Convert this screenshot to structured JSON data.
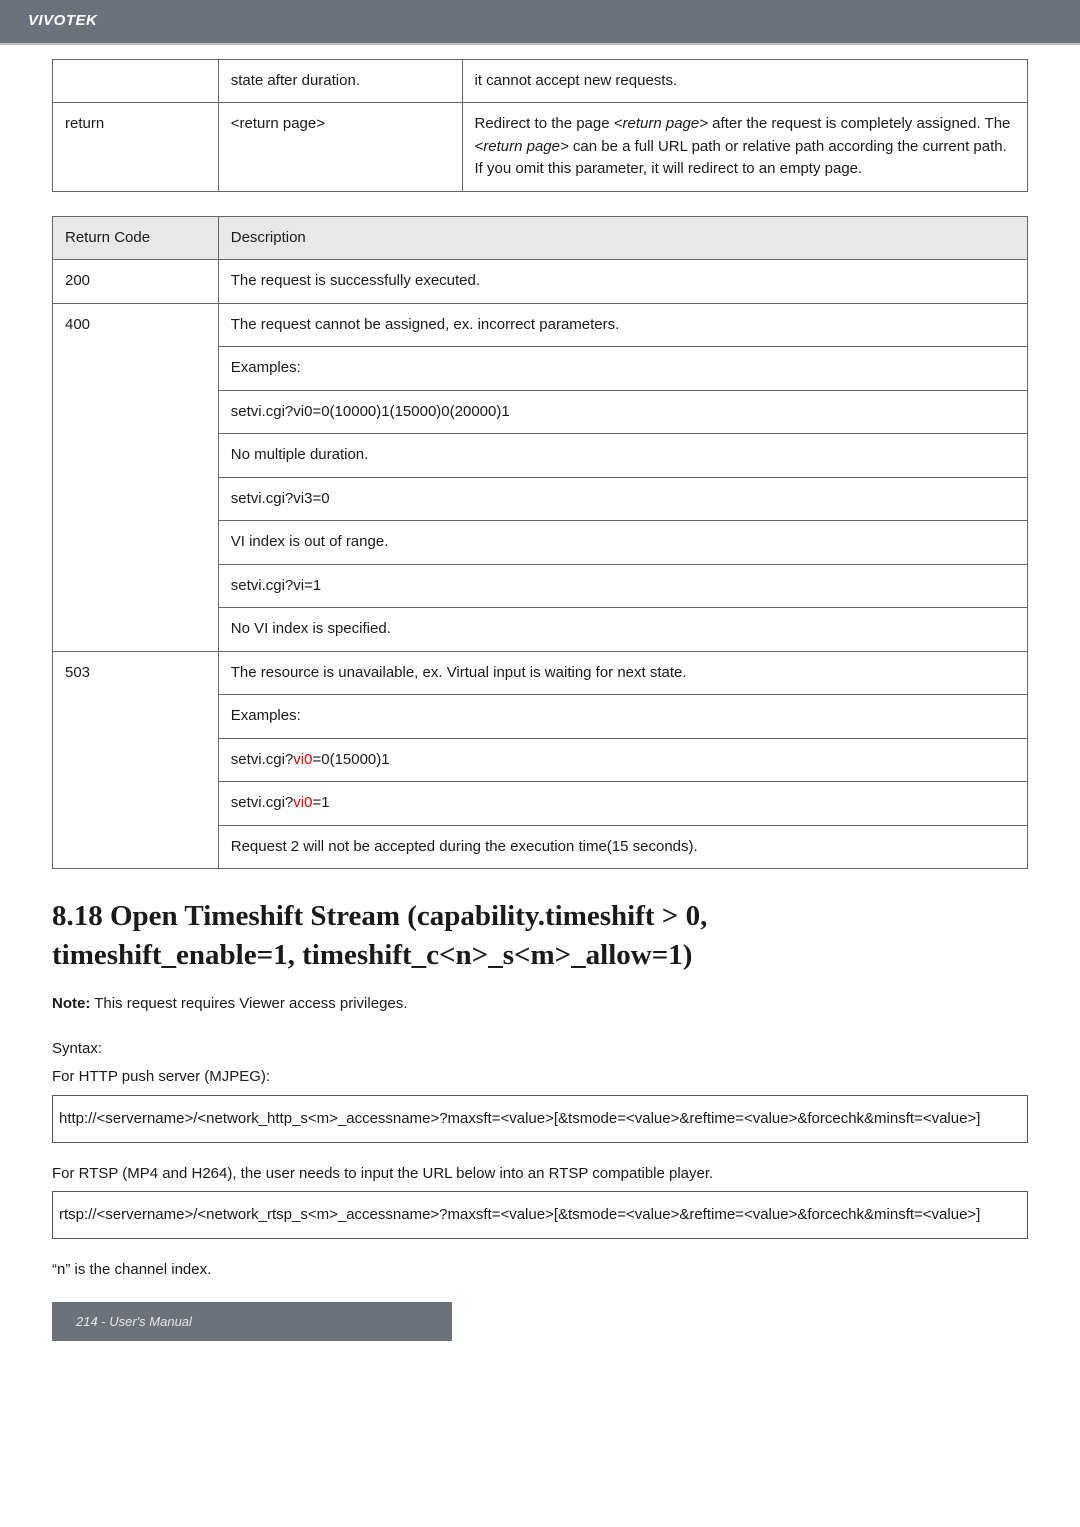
{
  "brand": "VIVOTEK",
  "table1": {
    "rows": [
      {
        "c1": "",
        "c2": "state after duration.",
        "c3": "it cannot accept new requests."
      },
      {
        "c1": "return",
        "c2": "<return page>",
        "c3_parts": {
          "a": "Redirect to the page ",
          "b_ital": "<return page>",
          "c": " after the request is completely assigned. The ",
          "d_ital": "<return page>",
          "e": " can be a full URL path or relative path according the current path. If you omit this parameter, it will redirect to an empty page."
        }
      }
    ]
  },
  "table2": {
    "header": {
      "code": "Return Code",
      "desc": "Description"
    },
    "rows": [
      {
        "code": "200",
        "lines": [
          "The request is successfully executed."
        ]
      },
      {
        "code": "400",
        "lines": [
          "The request cannot be assigned, ex. incorrect parameters.",
          "Examples:",
          "setvi.cgi?vi0=0(10000)1(15000)0(20000)1",
          "No multiple duration.",
          "setvi.cgi?vi3=0",
          "VI index is out of range.",
          "setvi.cgi?vi=1",
          "No VI index is specified."
        ]
      },
      {
        "code": "503",
        "lines_mixed": [
          {
            "plain": "The resource is unavailable, ex. Virtual input is waiting for next state."
          },
          {
            "plain": "Examples:"
          },
          {
            "pre": "setvi.cgi?",
            "red": "vi0",
            "post": "=0(15000)1"
          },
          {
            "pre": "setvi.cgi?",
            "red": "vi0",
            "post": "=1"
          },
          {
            "plain": "Request 2 will not be accepted during the execution time(15 seconds)."
          }
        ]
      }
    ]
  },
  "section_title_line1": "8.18 Open Timeshift Stream (capability.timeshift > 0,",
  "section_title_line2": "timeshift_enable=1, timeshift_c<n>_s<m>_allow=1)",
  "note_strong": "Note:",
  "note_text": " This request requires Viewer access privileges.",
  "syntax_label": "Syntax:",
  "http_label": "For HTTP push server (MJPEG):",
  "http_box": "http://<servername>/<network_http_s<m>_accessname>?maxsft=<value>[&tsmode=<value>&reftime=<value>&forcechk&minsft=<value>]",
  "rtsp_label": "For RTSP (MP4 and H264), the user needs to input the URL below into an RTSP compatible player.",
  "rtsp_box": "rtsp://<servername>/<network_rtsp_s<m>_accessname>?maxsft=<value>[&tsmode=<value>&reftime=<value>&forcechk&minsft=<value>]",
  "channel_note": "“n” is the channel index.",
  "footer": "214 - User's Manual"
}
